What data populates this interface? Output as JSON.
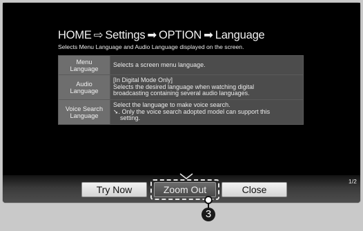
{
  "breadcrumb": {
    "home": "HOME",
    "sep1": "⇨",
    "settings": "Settings",
    "sep2": "➡",
    "option": "OPTION",
    "sep3": "➡",
    "language": "Language"
  },
  "subtitle": "Selects Menu Language and Audio Language displayed on the screen.",
  "options": [
    {
      "name": [
        "Menu",
        "Language"
      ],
      "desc": [
        "Selects a screen menu language."
      ]
    },
    {
      "name": [
        "Audio",
        "Language"
      ],
      "desc": [
        "[In Digital Mode Only]",
        "Selects the desired language when watching digital",
        "broadcasting containing several audio languages."
      ]
    },
    {
      "name": [
        "Voice Search",
        "Language"
      ],
      "desc": [
        "Select the language to make voice search."
      ],
      "note": [
        "➘. Only the voice search adopted model can support this",
        "setting."
      ]
    }
  ],
  "buttons": {
    "try_now": "Try Now",
    "zoom_out": "Zoom Out",
    "close": "Close"
  },
  "page_indicator": "1/2",
  "callout_number": "3"
}
